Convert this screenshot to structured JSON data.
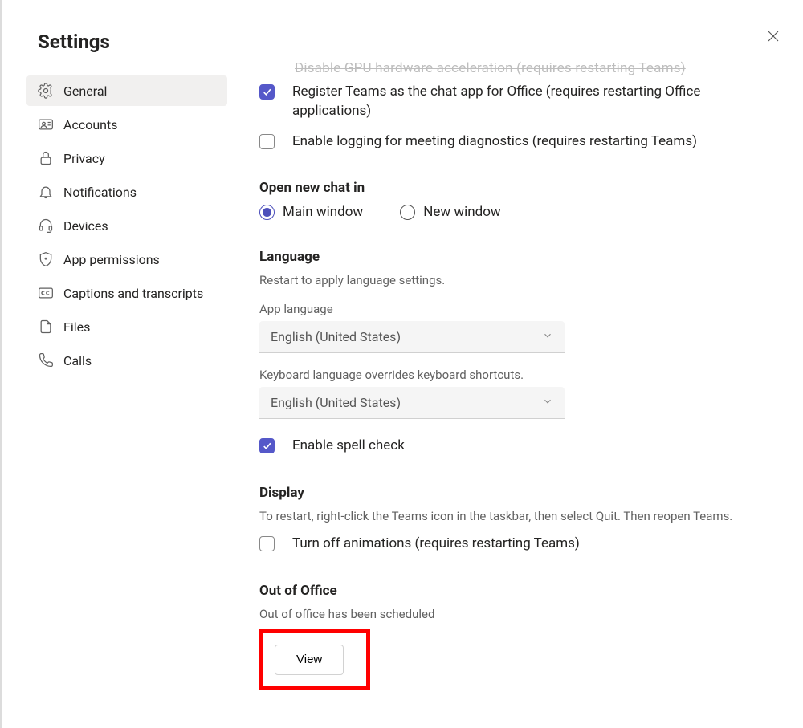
{
  "header": {
    "title": "Settings"
  },
  "sidebar": {
    "items": [
      {
        "label": "General"
      },
      {
        "label": "Accounts"
      },
      {
        "label": "Privacy"
      },
      {
        "label": "Notifications"
      },
      {
        "label": "Devices"
      },
      {
        "label": "App permissions"
      },
      {
        "label": "Captions and transcripts"
      },
      {
        "label": "Files"
      },
      {
        "label": "Calls"
      }
    ]
  },
  "main": {
    "cutoff_text": "Disable GPU hardware acceleration (requires restarting Teams)",
    "checkboxes": {
      "register_teams": "Register Teams as the chat app for Office (requires restarting Office applications)",
      "enable_logging": "Enable logging for meeting diagnostics (requires restarting Teams)"
    },
    "open_chat": {
      "title": "Open new chat in",
      "options": {
        "main": "Main window",
        "new": "New window"
      }
    },
    "language": {
      "title": "Language",
      "restart_hint": "Restart to apply language settings.",
      "app_lang_label": "App language",
      "app_lang_value": "English (United States)",
      "kbd_hint": "Keyboard language overrides keyboard shortcuts.",
      "kbd_value": "English (United States)",
      "spell_check": "Enable spell check"
    },
    "display": {
      "title": "Display",
      "hint": "To restart, right-click the Teams icon in the taskbar, then select Quit. Then reopen Teams.",
      "turn_off_anim": "Turn off animations (requires restarting Teams)"
    },
    "ooo": {
      "title": "Out of Office",
      "status": "Out of office has been scheduled",
      "view_btn": "View"
    }
  }
}
